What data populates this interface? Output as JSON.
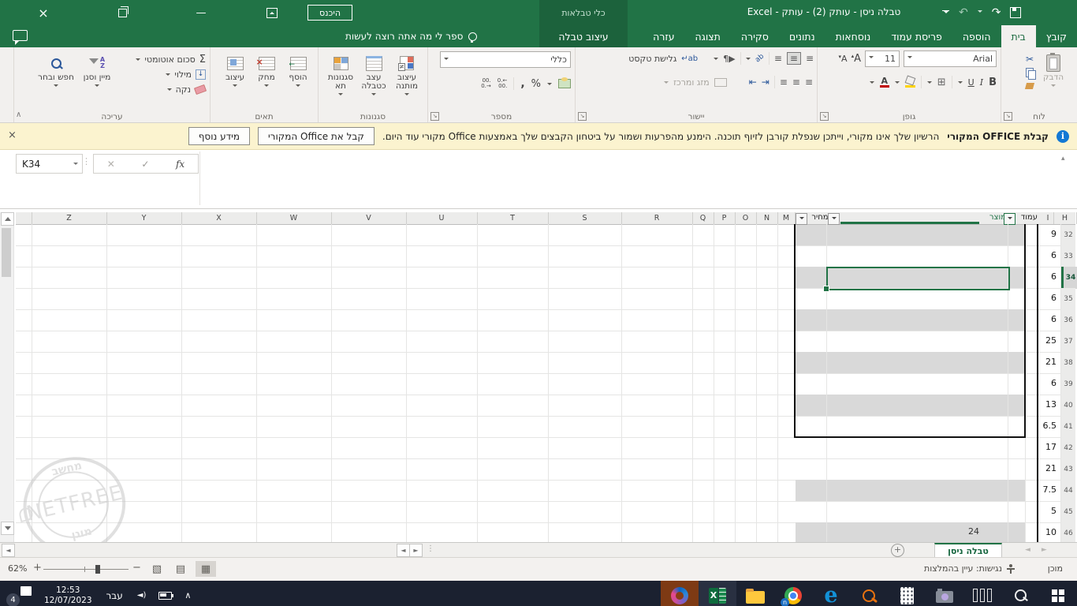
{
  "titlebar": {
    "signin": "היכנס",
    "title": "טבלה ניסן - עותק (2) - עותק  -  Excel",
    "tools_label": "כלי טבלאות"
  },
  "tabs": {
    "file": "קובץ",
    "main": [
      "בית",
      "הוספה",
      "פריסת עמוד",
      "נוסחאות",
      "נתונים",
      "סקירה",
      "תצוגה",
      "עזרה"
    ],
    "active_index": 0,
    "contextual": "עיצוב טבלה",
    "tellme": "ספר לי מה אתה רוצה לעשות"
  },
  "ribbon": {
    "clipboard": {
      "label": "לוח",
      "paste": "הדבק"
    },
    "font": {
      "label": "גופן",
      "name": "Arial",
      "size": "11"
    },
    "alignment": {
      "label": "יישור",
      "wrap": "גלישת טקסט",
      "merge": "מזג ומרכז"
    },
    "number": {
      "label": "מספר",
      "format": "כללי"
    },
    "styles": {
      "label": "סגנונות",
      "conditional": "עיצוב מותנה",
      "as_table": "עצב כטבלה",
      "cell_styles": "סגנונות תא"
    },
    "cells": {
      "label": "תאים",
      "insert": "הוסף",
      "del": "מחק",
      "format": "עיצוב"
    },
    "editing": {
      "label": "עריכה",
      "autosum": "סכום אוטומטי",
      "fill": "מילוי",
      "clear": "נקה",
      "sort": "מיין וסנן",
      "find": "חפש ובחר"
    }
  },
  "notif": {
    "title": "קבלת OFFICE המקורי",
    "message": "הרשיון שלך אינו מקורי, וייתכן שנפלת קורבן לזיוף תוכנה. הימנע מהפרעות ושמור על ביטחון הקבצים שלך באמצעות Office מקורי עוד היום.",
    "get_btn": "קבל את Office המקורי",
    "info_btn": "מידע נוסף"
  },
  "formula": {
    "namebox": "K34"
  },
  "grid": {
    "columns_left": [
      "Z",
      "Y",
      "X",
      "W",
      "V",
      "U",
      "T",
      "S",
      "R",
      "Q",
      "P",
      "O",
      "N",
      "M"
    ],
    "columns_right": [
      "I",
      "H"
    ],
    "table_headers": {
      "price": "מחיר",
      "product": "מוצר",
      "page": "עמוד"
    },
    "rows": [
      {
        "n": 32,
        "h": "9",
        "band": true
      },
      {
        "n": 33,
        "h": "6",
        "band": false
      },
      {
        "n": 34,
        "h": "6",
        "band": true,
        "selected": true
      },
      {
        "n": 35,
        "h": "6",
        "band": false
      },
      {
        "n": 36,
        "h": "6",
        "band": true
      },
      {
        "n": 37,
        "h": "25",
        "band": false
      },
      {
        "n": 38,
        "h": "21",
        "band": true
      },
      {
        "n": 39,
        "h": "6",
        "band": false
      },
      {
        "n": 40,
        "h": "13",
        "band": true
      },
      {
        "n": 41,
        "h": "6.5",
        "band": false
      },
      {
        "n": 42,
        "h": "17",
        "band": false
      },
      {
        "n": 43,
        "h": "21",
        "band": false
      },
      {
        "n": 44,
        "h": "7.5",
        "band": true
      },
      {
        "n": 45,
        "h": "5",
        "band": false
      },
      {
        "n": 46,
        "h": "10",
        "band": true
      }
    ],
    "partial_value": "24"
  },
  "watermark": {
    "top": "מחשב",
    "center": "NETFREE",
    "bottom": "מוגן"
  },
  "sheetbar": {
    "tab": "טבלה ניסן"
  },
  "status": {
    "ready": "מוכן",
    "accessibility": "נגישות: עיין בהמלצות",
    "zoom": "62%"
  },
  "taskbar": {
    "badge": "4",
    "time": "12:53",
    "date": "12/07/2023",
    "lang": "עבר"
  }
}
